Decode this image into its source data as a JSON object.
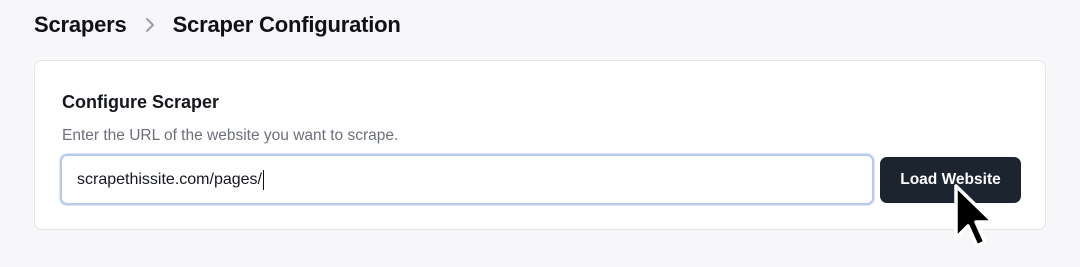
{
  "breadcrumb": {
    "root": "Scrapers",
    "separator_icon": "chevron-right-icon",
    "current": "Scraper Configuration"
  },
  "card": {
    "title": "Configure Scraper",
    "description": "Enter the URL of the website you want to scrape.",
    "url_input": {
      "value": "scrapethissite.com/pages/",
      "focused": true
    },
    "load_button": {
      "label": "Load Website"
    }
  },
  "cursor": {
    "type": "arrow-pointer",
    "icon": "mouse-cursor-icon"
  },
  "colors": {
    "background": "#f7f7f9",
    "card": "#ffffff",
    "button": "#1c2430",
    "input_focus_border": "#b8c9ef",
    "muted_text": "#6b7079"
  }
}
